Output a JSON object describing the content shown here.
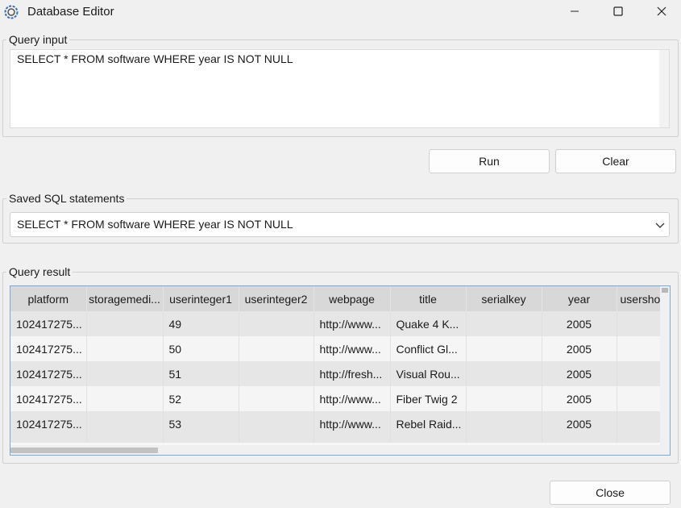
{
  "window": {
    "title": "Database Editor"
  },
  "query_input": {
    "label": "Query input",
    "value": "SELECT * FROM software WHERE year IS NOT NULL"
  },
  "buttons": {
    "run": "Run",
    "clear": "Clear",
    "close": "Close"
  },
  "saved": {
    "label": "Saved SQL statements",
    "selected": "SELECT * FROM software WHERE year IS NOT NULL"
  },
  "result": {
    "label": "Query result",
    "columns": [
      "platform",
      "storagemedi...",
      "userinteger1",
      "userinteger2",
      "webpage",
      "title",
      "serialkey",
      "year",
      "usersho"
    ],
    "rows": [
      [
        "102417275...",
        "",
        "49",
        "",
        "http://www...",
        "Quake 4 K...",
        "",
        "2005",
        ""
      ],
      [
        "102417275...",
        "",
        "50",
        "",
        "http://www...",
        "Conflict Gl...",
        "",
        "2005",
        ""
      ],
      [
        "102417275...",
        "",
        "51",
        "",
        "http://fresh...",
        "Visual Rou...",
        "",
        "2005",
        ""
      ],
      [
        "102417275...",
        "",
        "52",
        "",
        "http://www...",
        "Fiber Twig 2",
        "",
        "2005",
        ""
      ],
      [
        "102417275...",
        "",
        "53",
        "",
        "http://www...",
        "Rebel Raid...",
        "",
        "2005",
        ""
      ]
    ]
  },
  "icons": {
    "app": "gear-icon",
    "minimize": "minimize-icon",
    "maximize": "maximize-icon",
    "close": "close-icon",
    "dropdown": "chevron-down-icon"
  }
}
